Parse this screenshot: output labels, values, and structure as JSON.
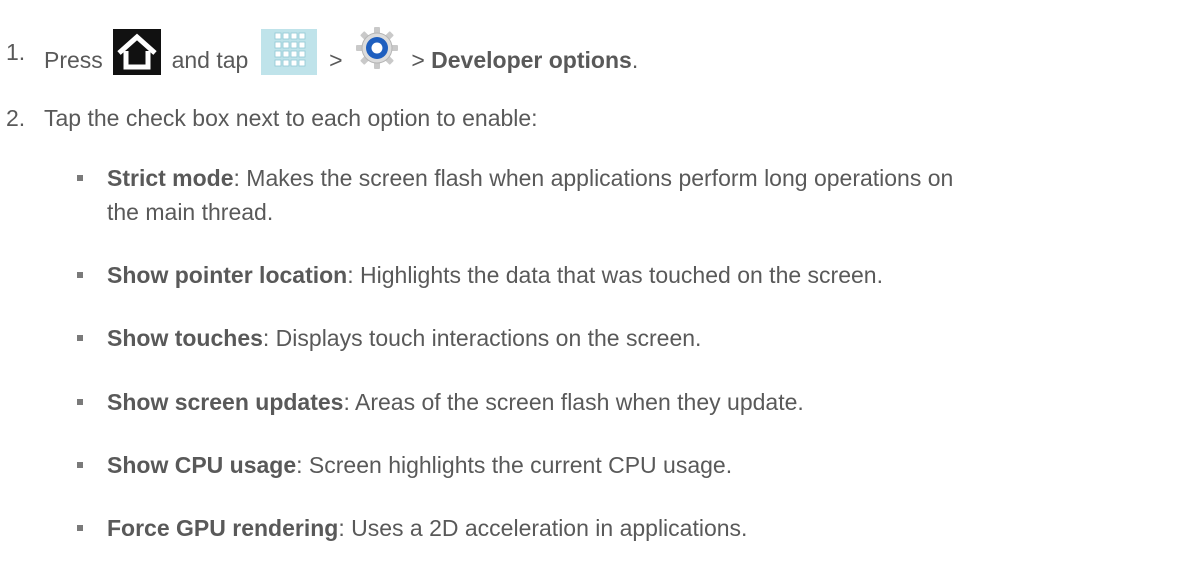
{
  "steps": [
    {
      "number": "1.",
      "press": "Press",
      "and_tap": "and tap",
      "sep1": ">",
      "sep2": ">",
      "target": "Developer options",
      "period": ".",
      "icons": [
        "home-icon",
        "apps-icon",
        "settings-gear-icon"
      ]
    },
    {
      "number": "2.",
      "text": "Tap the check box next to each option to enable:"
    }
  ],
  "options": [
    {
      "term": "Strict mode",
      "desc": ": Makes the screen flash when applications perform long operations on",
      "desc2": "the main thread."
    },
    {
      "term": "Show pointer location",
      "desc": ": Highlights the data that was touched on the screen."
    },
    {
      "term": "Show touches",
      "desc": ": Displays touch interactions on the screen."
    },
    {
      "term": "Show screen updates",
      "desc": ": Areas of the screen flash when they update."
    },
    {
      "term": "Show CPU usage",
      "desc": ": Screen highlights the current CPU usage."
    },
    {
      "term": "Force GPU rendering",
      "desc": ": Uses a 2D acceleration in applications."
    }
  ],
  "colors": {
    "text": "#595959",
    "apps_icon_bg": "#bfe3ea",
    "gear_blue": "#1f5fbf"
  }
}
